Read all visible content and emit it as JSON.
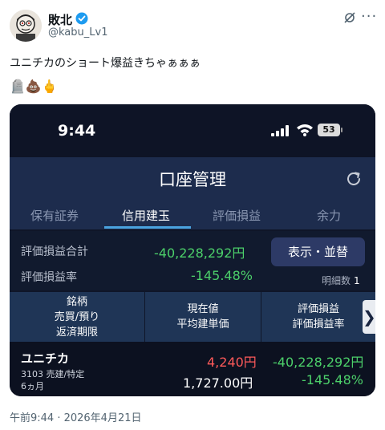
{
  "tweet": {
    "username": "敗北",
    "handle": "@kabu_Lv1",
    "text": "ユニチカのショート爆益きちゃぁぁぁ",
    "emojis": "🪦💩🖕",
    "timestamp": "午前9:44 · 2026年4月21日",
    "verified_color": "#1d9bf0"
  },
  "phone": {
    "time": "9:44",
    "battery": "53"
  },
  "app": {
    "title": "口座管理",
    "tabs": [
      "保有証券",
      "信用建玉",
      "評価損益",
      "余力"
    ],
    "active_tab": "信用建玉",
    "summary": {
      "total_label": "評価損益合計",
      "total_value": "-40,228,292円",
      "rate_label": "評価損益率",
      "rate_value": "-145.48%",
      "display_button": "表示・並替",
      "detail_label": "明細数",
      "detail_count": "1"
    },
    "table_headers": {
      "col1": [
        "銘柄",
        "売買/預り",
        "返済期限"
      ],
      "col2": [
        "現在値",
        "平均建単価"
      ],
      "col3": [
        "評価損益",
        "評価損益率"
      ]
    },
    "rows": [
      {
        "name": "ユニチカ",
        "code_type": "3103 売建/特定",
        "period": "6ヵ月",
        "current_price": "4,240円",
        "avg_price": "1,727.00円",
        "pl": "-40,228,292円",
        "pl_rate": "-145.48%"
      }
    ],
    "colors": {
      "gain": "#4cd06a",
      "loss": "#ff5a5a",
      "tab_accent": "#4aa3df"
    }
  }
}
